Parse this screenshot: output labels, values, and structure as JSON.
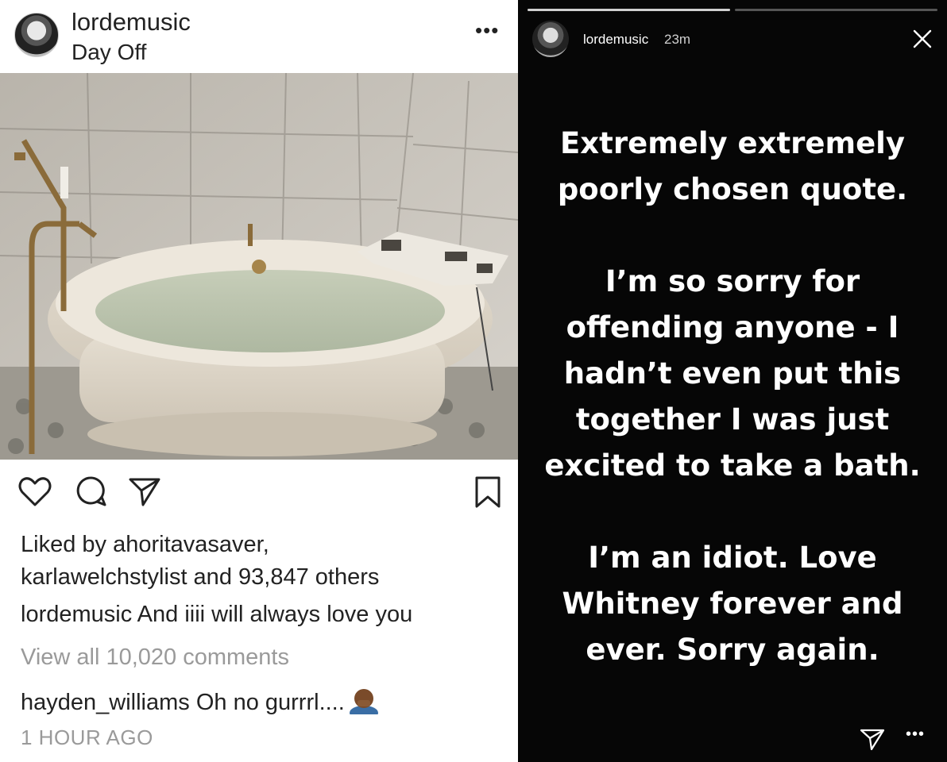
{
  "post": {
    "username": "lordemusic",
    "location": "Day Off",
    "more_icon": "ellipsis-icon",
    "likes": {
      "prefix": "Liked by ",
      "user1": "ahoritavasaver,",
      "user2": "karlawelchstylist",
      "mid": " and ",
      "count": "93,847 others"
    },
    "caption": {
      "user": "lordemusic",
      "text": " And iiii will always love you"
    },
    "view_all": "View all 10,020 comments",
    "comment": {
      "user": "hayden_williams",
      "text": " Oh no gurrrl...."
    },
    "timestamp": "1 HOUR AGO"
  },
  "story": {
    "username": "lordemusic",
    "time": "23m",
    "progress": [
      1.0,
      0.0
    ],
    "paragraphs": [
      "Extremely extremely poorly chosen quote.",
      "I’m so sorry for offending anyone - I hadn’t even put this together I was just excited to take a bath.",
      "I’m an idiot. Love Whitney forever and ever. Sorry again."
    ],
    "colors": {
      "background": "#060606",
      "text": "#ffffff"
    }
  }
}
